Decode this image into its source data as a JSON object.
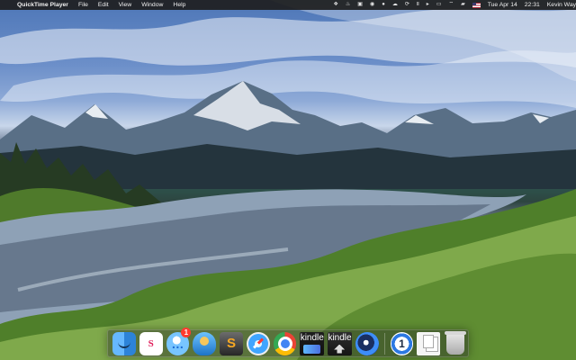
{
  "menubar": {
    "apple": "",
    "app_name": "QuickTime Player",
    "menus": [
      "File",
      "Edit",
      "View",
      "Window",
      "Help"
    ],
    "status_icons": [
      "dropbox-icon",
      "flame-icon",
      "screen-icon",
      "circle-icon",
      "user-icon",
      "cloud-icon",
      "sync-icon",
      "pause-icon",
      "play-icon",
      "airplay-icon",
      "wifi-icon",
      "battery-icon",
      "us-flag-icon"
    ],
    "date": "Tue Apr 14",
    "time": "22:31",
    "user": "Kevin Way"
  },
  "dock": {
    "items": [
      {
        "name": "Finder",
        "icon": "finder-icon",
        "label": ""
      },
      {
        "name": "Slack",
        "icon": "slack-icon",
        "label": "S"
      },
      {
        "name": "Messages",
        "icon": "messages-icon",
        "label": "…",
        "badge": "1"
      },
      {
        "name": "Tweetbot",
        "icon": "bird-icon",
        "label": ""
      },
      {
        "name": "Scrivener",
        "icon": "scrivener-icon",
        "label": "S"
      },
      {
        "name": "Safari",
        "icon": "compass-icon",
        "label": ""
      },
      {
        "name": "Chrome",
        "icon": "chrome-icon",
        "label": ""
      },
      {
        "name": "Kindle",
        "icon": "kindle-icon",
        "label": "kindle"
      },
      {
        "name": "Kindle Previewer",
        "icon": "kindle-upload-icon",
        "label": "kindle"
      },
      {
        "name": "Sync app",
        "icon": "sync-icon",
        "label": ""
      },
      {
        "name": "1Password",
        "icon": "key-icon",
        "label": "1"
      },
      {
        "name": "Documents",
        "icon": "documents-icon",
        "label": ""
      },
      {
        "name": "Trash",
        "icon": "trash-icon",
        "label": ""
      }
    ]
  }
}
